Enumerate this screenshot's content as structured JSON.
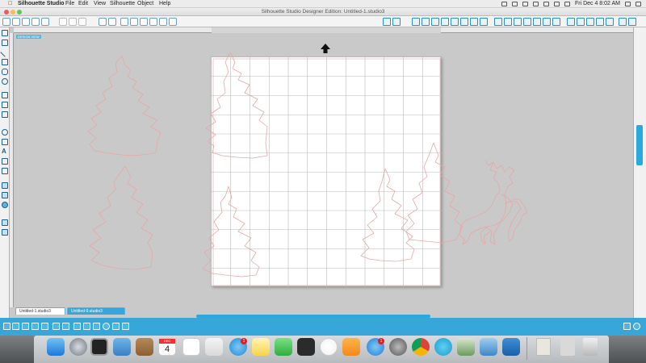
{
  "menubar": {
    "apple_label": "",
    "app_name": "Silhouette Studio",
    "items": [
      "File",
      "Edit",
      "View",
      "Silhouette",
      "Object",
      "Help"
    ],
    "clock": "Fri Dec 4  8:02 AM"
  },
  "window": {
    "title": "Silhouette Studio Designer Edition: Untitled-1.studio3"
  },
  "canvas": {
    "view_label": "DESIGN VIEW"
  },
  "documents": {
    "tabs": [
      "Untitled-1.studio3",
      "Untitled-9.studio3"
    ]
  },
  "dock": {
    "calendar_month": "DEC",
    "calendar_day": "4",
    "badges": {
      "messages": "1",
      "ibooks": "1"
    }
  },
  "colors": {
    "accent": "#2aa9dd",
    "shape_stroke": "#e9a6a6",
    "grid": "#b9b9b9"
  },
  "icons": {
    "mat_direction": "up-arrow-icon",
    "tools": [
      "select-icon",
      "point-edit-icon",
      "line-icon",
      "rectangle-icon",
      "rounded-rectangle-icon",
      "ellipse-icon",
      "polygon-icon",
      "curve-icon",
      "arc-icon",
      "freehand-icon",
      "smooth-freehand-icon",
      "text-icon",
      "eraser-icon",
      "knife-icon",
      "fill-icon",
      "pages-icon",
      "library-icon",
      "store-icon"
    ]
  }
}
